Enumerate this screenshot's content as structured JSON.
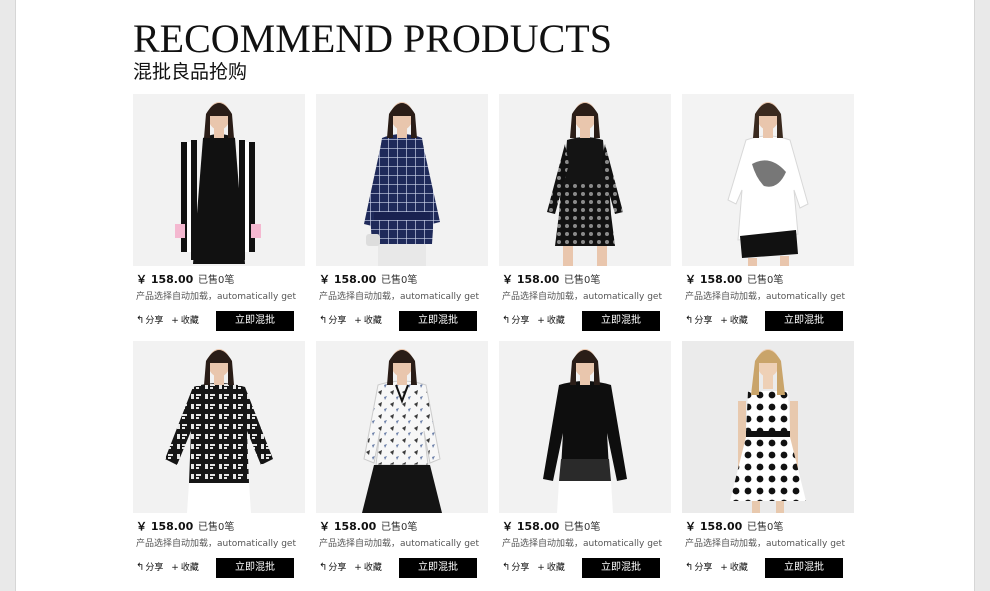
{
  "header": {
    "title_en": "RECOMMEND PRODUCTS",
    "title_cn": "混批良品抢购"
  },
  "products": [
    {
      "price": "￥ 158.00",
      "sold": "已售0笔",
      "desc": "产品选择自动加载，automatically get",
      "share_label": "分享",
      "fav_label": "收藏",
      "buy_label": "立即混批",
      "outfit": "striped-blazer"
    },
    {
      "price": "￥ 158.00",
      "sold": "已售0笔",
      "desc": "产品选择自动加载，automatically get",
      "share_label": "分享",
      "fav_label": "收藏",
      "buy_label": "立即混批",
      "outfit": "plaid-blouse"
    },
    {
      "price": "￥ 158.00",
      "sold": "已售0笔",
      "desc": "产品选择自动加载，automatically get",
      "share_label": "分享",
      "fav_label": "收藏",
      "buy_label": "立即混批",
      "outfit": "lace-top"
    },
    {
      "price": "￥ 158.00",
      "sold": "已售0笔",
      "desc": "产品选择自动加载，automatically get",
      "share_label": "分享",
      "fav_label": "收藏",
      "buy_label": "立即混批",
      "outfit": "white-print-top"
    },
    {
      "price": "￥ 158.00",
      "sold": "已售0笔",
      "desc": "产品选择自动加载，automatically get",
      "share_label": "分享",
      "fav_label": "收藏",
      "buy_label": "立即混批",
      "outfit": "letter-sweater"
    },
    {
      "price": "￥ 158.00",
      "sold": "已售0笔",
      "desc": "产品选择自动加载，automatically get",
      "share_label": "分享",
      "fav_label": "收藏",
      "buy_label": "立即混批",
      "outfit": "printed-blouse"
    },
    {
      "price": "￥ 158.00",
      "sold": "已售0笔",
      "desc": "产品选择自动加载，automatically get",
      "share_label": "分享",
      "fav_label": "收藏",
      "buy_label": "立即混批",
      "outfit": "black-blouse"
    },
    {
      "price": "￥ 158.00",
      "sold": "已售0笔",
      "desc": "产品选择自动加载，automatically get",
      "share_label": "分享",
      "fav_label": "收藏",
      "buy_label": "立即混批",
      "outfit": "polka-dress"
    }
  ],
  "icons": {
    "share": "share-arrow-icon",
    "fav": "plus-icon"
  },
  "colors": {
    "button_bg": "#000000",
    "button_text": "#ffffff",
    "page_bg": "#ffffff"
  }
}
